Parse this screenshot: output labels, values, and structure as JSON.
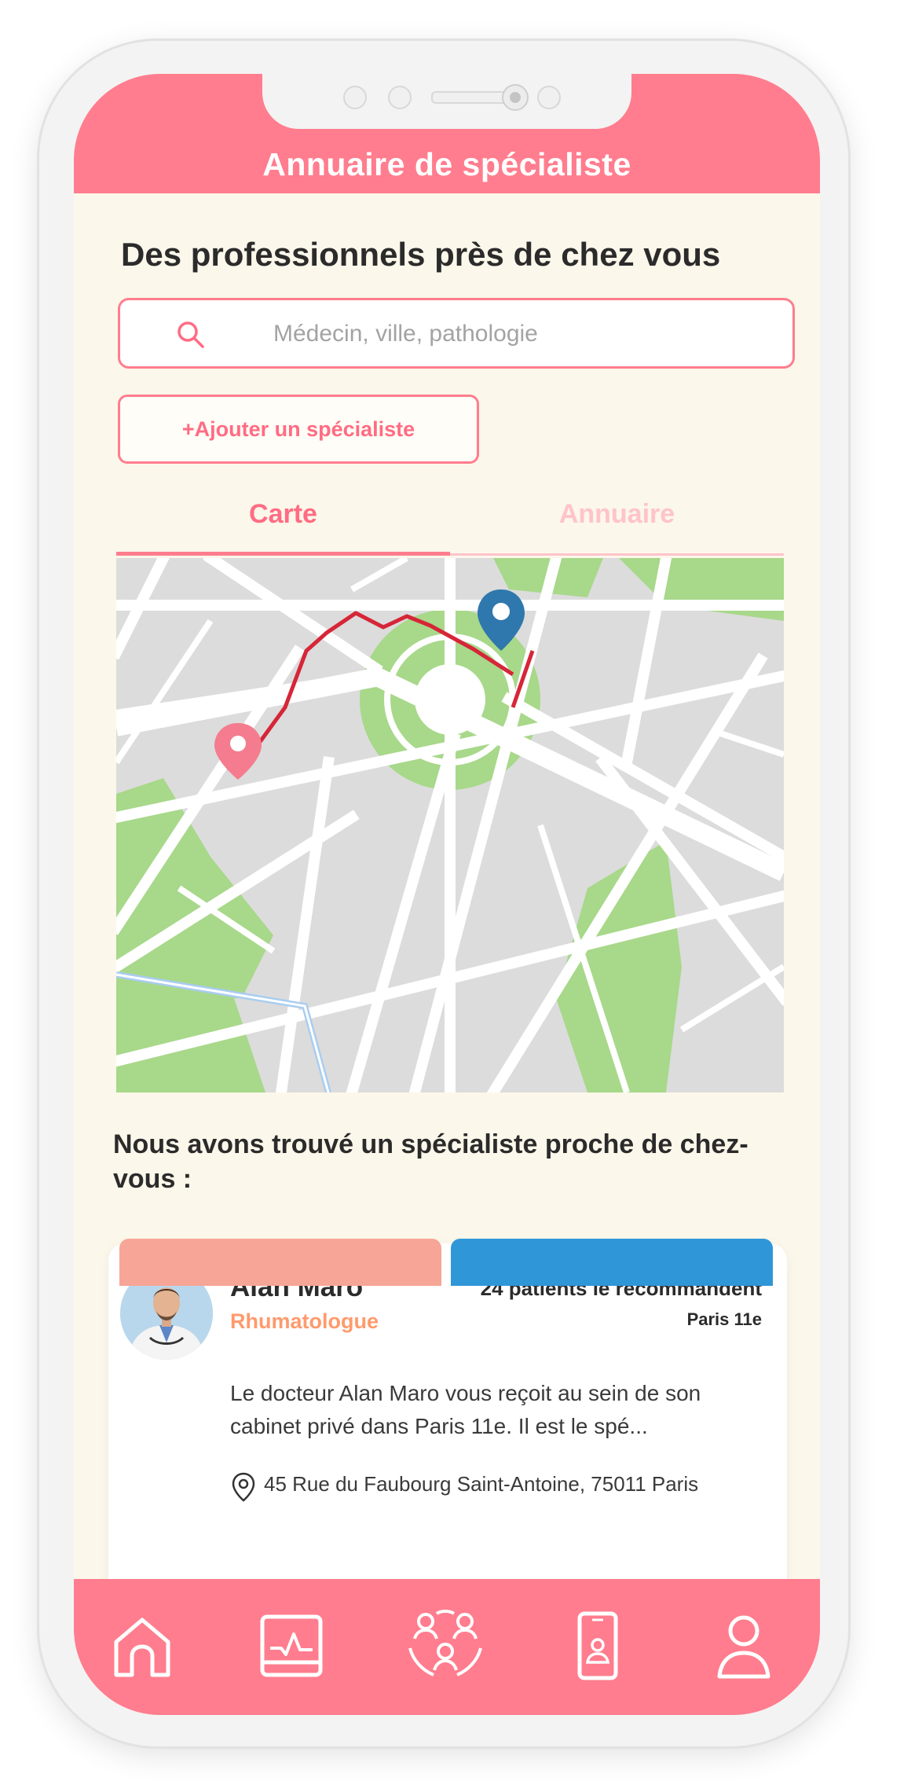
{
  "app": {
    "title": "Annuaire de spécialiste"
  },
  "main": {
    "heading": "Des professionnels près de chez vous",
    "search": {
      "placeholder": "Médecin, ville, pathologie"
    },
    "add_button": "+Ajouter un spécialiste",
    "tabs": [
      {
        "label": "Carte",
        "active": true
      },
      {
        "label": "Annuaire",
        "active": false
      }
    ],
    "results_title": "Nous avons trouvé un spécialiste proche de chez-vous :"
  },
  "specialist": {
    "name": "Alan Maro",
    "specialty": "Rhumatologue",
    "recommendations": "24 patients le recommandent",
    "district": "Paris 11e",
    "description": "Le docteur Alan Maro vous reçoit au sein de son cabinet privé dans Paris 11e. Il est le spé...",
    "address": "45 Rue du Faubourg Saint-Antoine, 75011 Paris"
  },
  "navbar": {
    "items": [
      "home-icon",
      "health-chart-icon",
      "community-icon",
      "phone-contact-icon",
      "profile-icon"
    ]
  },
  "colors": {
    "brand": "#ff7d8e",
    "background": "#fbf7ea",
    "accent_orange": "#ff9a6c",
    "accent_blue": "#2f96d8",
    "route": "#d62638"
  }
}
